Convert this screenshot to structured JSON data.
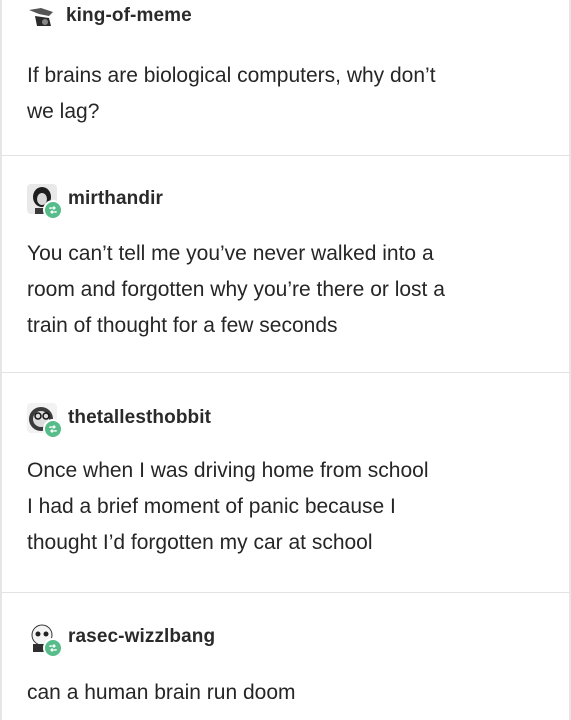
{
  "posts": [
    {
      "username": "king-of-meme",
      "lines": [
        "If brains are biological computers, why don’t",
        "we lag?"
      ],
      "avatar_icon": "meme-avatar-icon",
      "reblog": false
    },
    {
      "username": "mirthandir",
      "lines": [
        "You can’t tell me you’ve never walked into a",
        "room and forgotten why you’re there or lost a",
        "train of thought for a few seconds"
      ],
      "avatar_icon": "portrait-avatar-icon",
      "reblog": true
    },
    {
      "username": "thetallesthobbit",
      "lines": [
        "Once when I was driving home from school",
        "I had a brief moment of panic because I",
        "thought I’d forgotten my car at school"
      ],
      "avatar_icon": "glasses-avatar-icon",
      "reblog": true
    },
    {
      "username": "rasec-wizzlbang",
      "lines": [
        "can a human brain run doom"
      ],
      "avatar_icon": "skull-avatar-icon",
      "reblog": true
    }
  ],
  "colors": {
    "reblog_badge": "#56bc8a",
    "divider": "#e3e3e3",
    "text": "#262626"
  }
}
